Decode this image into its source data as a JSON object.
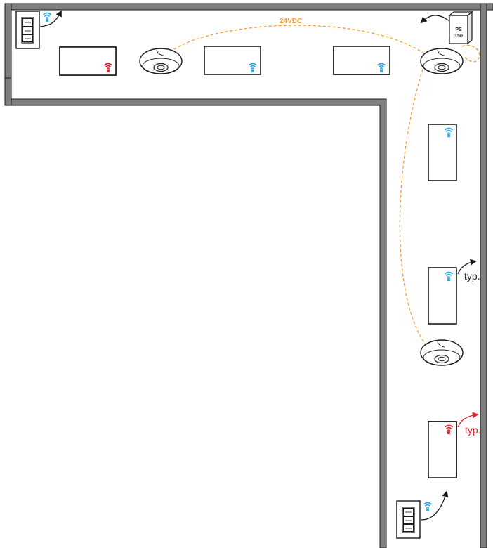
{
  "colors": {
    "wall": "#7f7f7f",
    "shade": "#8c8c8c",
    "wiring": "#f39c33",
    "wireless_blue": "#29a8e0",
    "wireless_red": "#e0202a",
    "arrow_black": "#1a1a1a",
    "arrow_red": "#e0202a"
  },
  "labels": {
    "wiring": "24VDC",
    "typ_black": "typ.",
    "typ_red": "typ.",
    "power_supply_line1": "PS",
    "power_supply_line2": "150"
  },
  "icons": {
    "wireless": "wifi-signal-icon",
    "arrow": "curved-arrow-icon",
    "sensor": "ceiling-occupancy-sensor",
    "switch": "wall-keypad-switch"
  }
}
